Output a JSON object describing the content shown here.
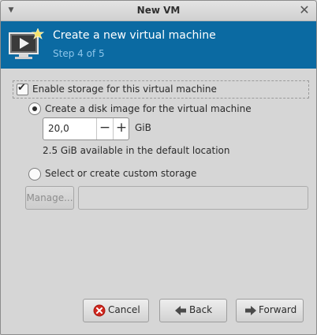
{
  "window": {
    "title": "New VM"
  },
  "header": {
    "title": "Create a new virtual machine",
    "step": "Step 4 of 5"
  },
  "storage": {
    "enable_label": "Enable storage for this virtual machine",
    "enabled": true,
    "disk_option_label": "Create a disk image for the virtual machine",
    "disk_size": "20,0",
    "unit": "GiB",
    "available_text": "2.5 GiB available in the default location",
    "custom_option_label": "Select or create custom storage",
    "manage_label": "Manage...",
    "custom_path": ""
  },
  "buttons": {
    "cancel": "Cancel",
    "back": "Back",
    "forward": "Forward"
  },
  "icons": {
    "menu": "chevron-down-icon",
    "close": "close-icon",
    "header": "monitor-play-icon",
    "cancel": "cancel-icon",
    "back": "arrow-left-icon",
    "forward": "arrow-right-icon"
  },
  "colors": {
    "header_bg": "#0b6aa2",
    "step_text": "#8cc5ea"
  }
}
